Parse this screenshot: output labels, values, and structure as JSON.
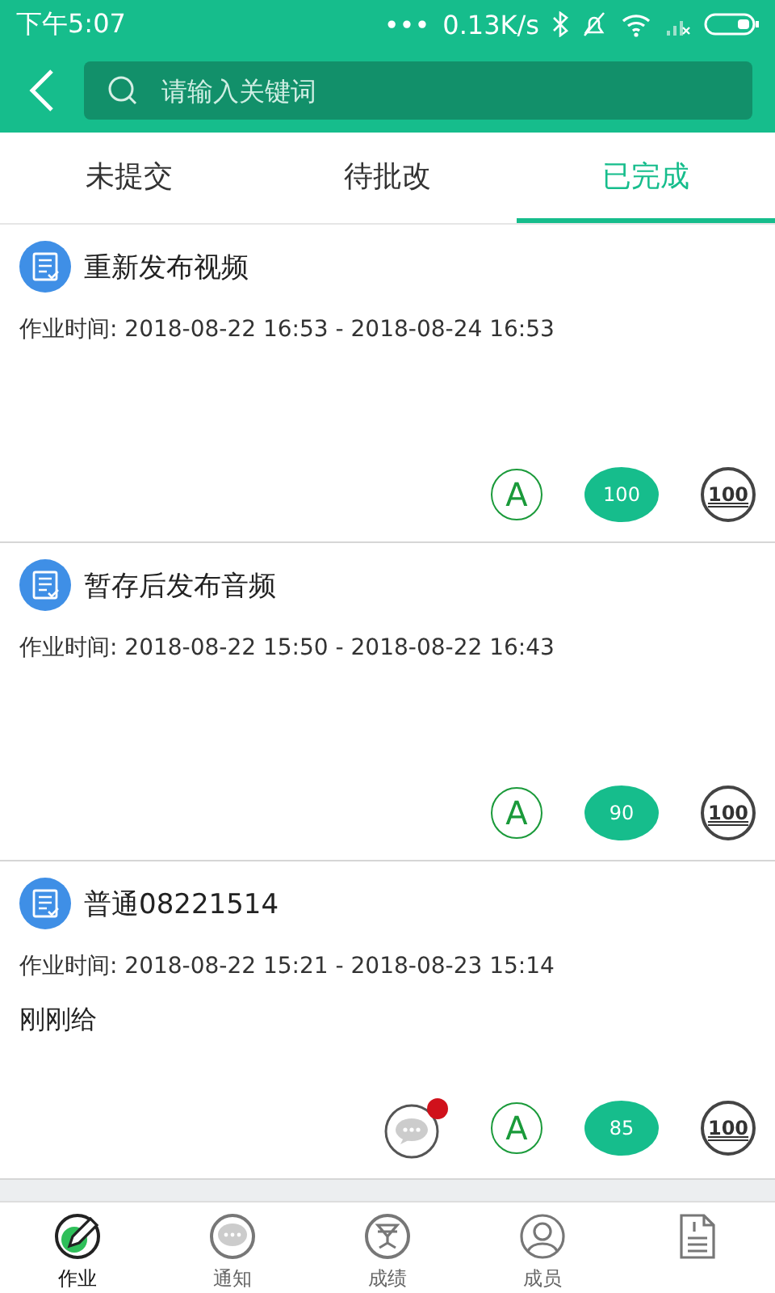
{
  "status_bar": {
    "time": "下午5:07",
    "dots": "•••",
    "speed": "0.13K/s"
  },
  "search": {
    "placeholder": "请输入关键词"
  },
  "tabs": [
    {
      "label": "未提交",
      "selected": false
    },
    {
      "label": "待批改",
      "selected": false
    },
    {
      "label": "已完成",
      "selected": true
    }
  ],
  "assignments": [
    {
      "title": "重新发布视频",
      "time": "作业时间: 2018-08-22 16:53 - 2018-08-24 16:53",
      "grade": "A",
      "score": "100",
      "stamp": "100"
    },
    {
      "title": "暂存后发布音频",
      "time": "作业时间: 2018-08-22 15:50 - 2018-08-22 16:43",
      "grade": "A",
      "score": "90",
      "stamp": "100"
    },
    {
      "title": "普通08221514",
      "time": "作业时间: 2018-08-22 15:21 - 2018-08-23 15:14",
      "note": "刚刚给",
      "comment": {
        "unread": true
      },
      "grade": "A",
      "score": "85",
      "stamp": "100"
    }
  ],
  "bottom_nav": [
    {
      "kind": "pencil",
      "label": "作业",
      "selected": true
    },
    {
      "kind": "chat",
      "label": "通知",
      "selected": false
    },
    {
      "kind": "trophy",
      "label": "成绩",
      "selected": false
    },
    {
      "kind": "person",
      "label": "成员",
      "selected": false
    },
    {
      "kind": "doc",
      "selected": false
    }
  ]
}
